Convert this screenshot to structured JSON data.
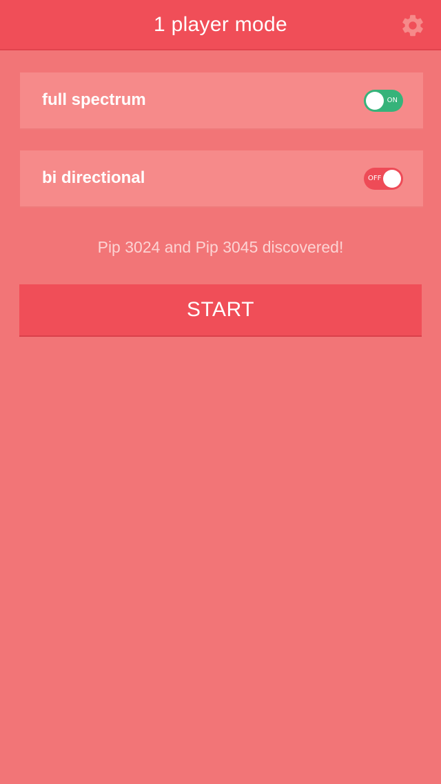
{
  "header": {
    "title": "1 player mode",
    "settings_icon": "gear-icon"
  },
  "options": [
    {
      "label": "full spectrum",
      "toggle_state": "ON",
      "enabled": true,
      "toggle_color": "#36b37a"
    },
    {
      "label": "bi directional",
      "toggle_state": "OFF",
      "enabled": false,
      "toggle_color": "#ee4b57"
    }
  ],
  "status": {
    "message": "Pip 3024  and Pip 3045 discovered!"
  },
  "start_button": {
    "label": "START"
  },
  "colors": {
    "background": "#f27577",
    "header": "#f04e58",
    "row": "#f68a8a",
    "on": "#36b37a",
    "off": "#ee4b57"
  }
}
